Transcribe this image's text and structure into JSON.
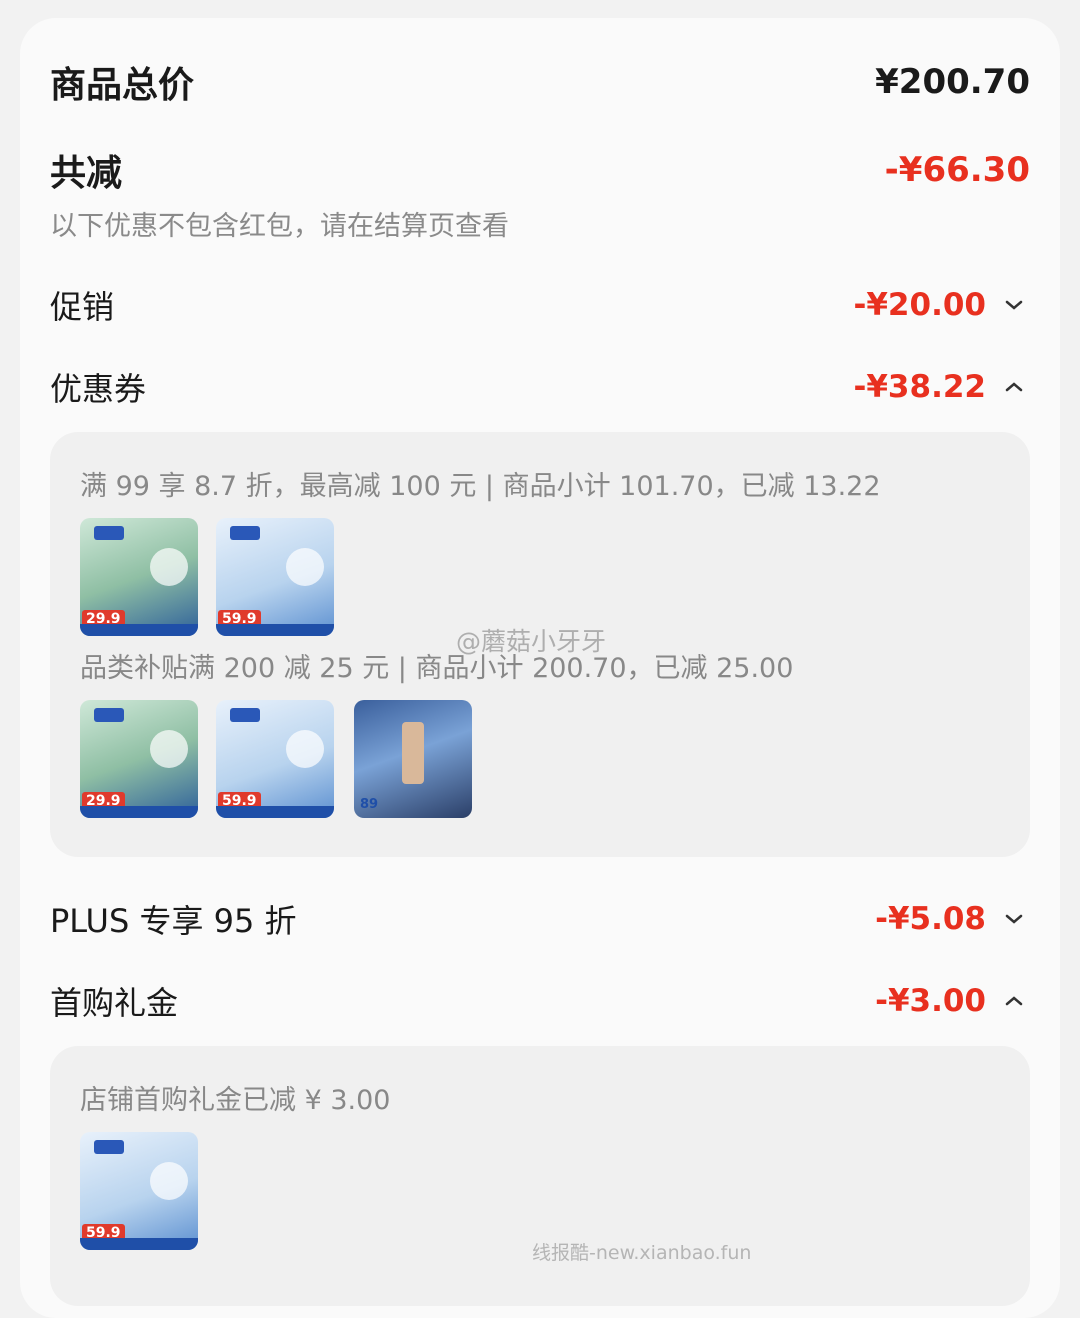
{
  "summary": {
    "total_label": "商品总价",
    "total_value": "¥200.70",
    "reduce_label": "共减",
    "reduce_value": "-¥66.30",
    "note": "以下优惠不包含红包，请在结算页查看"
  },
  "discounts": [
    {
      "label": "促销",
      "value": "-¥20.00",
      "chevron": "chevron-down-icon"
    },
    {
      "label": "优惠券",
      "value": "-¥38.22",
      "chevron": "chevron-up-icon"
    },
    {
      "label": "PLUS 专享 95 折",
      "value": "-¥5.08",
      "chevron": "chevron-down-icon"
    },
    {
      "label": "首购礼金",
      "value": "-¥3.00",
      "chevron": "chevron-up-icon"
    }
  ],
  "coupon_details": [
    {
      "text": "满 99 享 8.7 折，最高减 100 元 | 商品小计 101.70，已减 13.22",
      "thumb_labels": [
        "29.9",
        "59.9"
      ]
    },
    {
      "text": "品类补贴满 200 减 25 元 | 商品小计 200.70，已减 25.00",
      "thumb_labels": [
        "29.9",
        "59.9",
        "89"
      ]
    }
  ],
  "gift_detail": {
    "text": "店铺首购礼金已减 ¥ 3.00",
    "thumb_labels": [
      "59.9"
    ]
  },
  "watermarks": {
    "weibo": "@蘑菇小牙牙",
    "site": "线报酷-new.xianbao.fun"
  },
  "colors": {
    "accent_red": "#e8301f",
    "panel_bg": "#f0f0f0"
  }
}
